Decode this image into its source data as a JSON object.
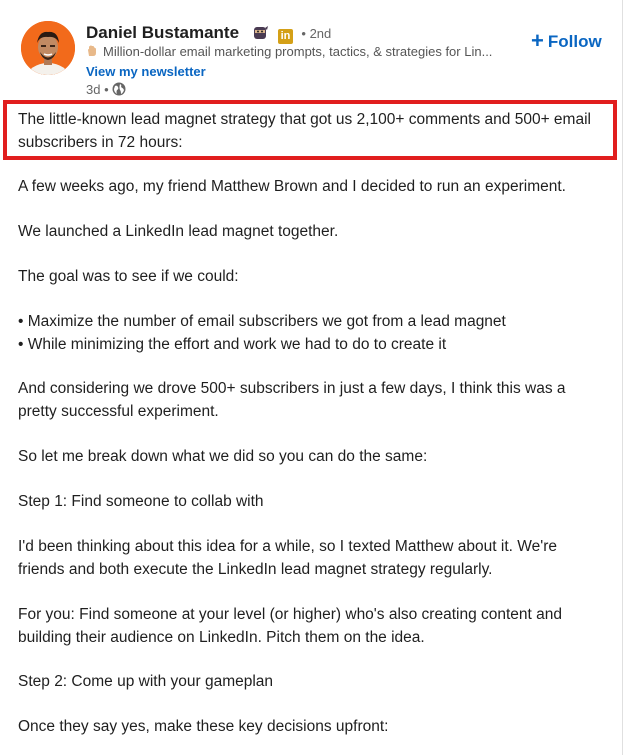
{
  "post": {
    "author": {
      "name": "Daniel Bustamante",
      "degree": "• 2nd",
      "tagline": "Million-dollar email marketing prompts, tactics, & strategies for Lin...",
      "newsletter_link": "View my newsletter",
      "time": "3d •",
      "icons": [
        "ninja-emoji-icon",
        "linkedin-premium-icon",
        "raised-hand-emoji-icon",
        "globe-icon"
      ]
    },
    "follow_label": "Follow",
    "colors": {
      "link": "#0a66c2",
      "highlight_border": "#e11e1e",
      "avatar_bg": "#f26a1b"
    },
    "highlighted_lines": [
      "The little-known lead magnet strategy that got us 2,100+ comments and 500+ email",
      "subscribers in 72 hours:"
    ],
    "body_lines": [
      "A few weeks ago, my friend Matthew Brown and I decided to run an experiment.",
      "We launched a LinkedIn lead magnet together.",
      "The goal was to see if we could:",
      "• Maximize the number of email subscribers we got from a lead magnet",
      "• While minimizing the effort and work we had to do to create it",
      "And considering we drove 500+ subscribers in just a few days, I think this was a",
      "pretty successful experiment.",
      "So let me break down what we did so you can do the same:",
      "Step 1: Find someone to collab with",
      "I'd been thinking about this idea for a while, so I texted Matthew about it. We're",
      "friends and both execute the LinkedIn lead magnet strategy regularly.",
      "For you: Find someone at your level (or higher) who's also creating content and",
      "building their audience on LinkedIn. Pitch them on the idea.",
      "Step 2: Come up with your gameplan",
      "Once they say yes, make these key decisions upfront:"
    ]
  }
}
